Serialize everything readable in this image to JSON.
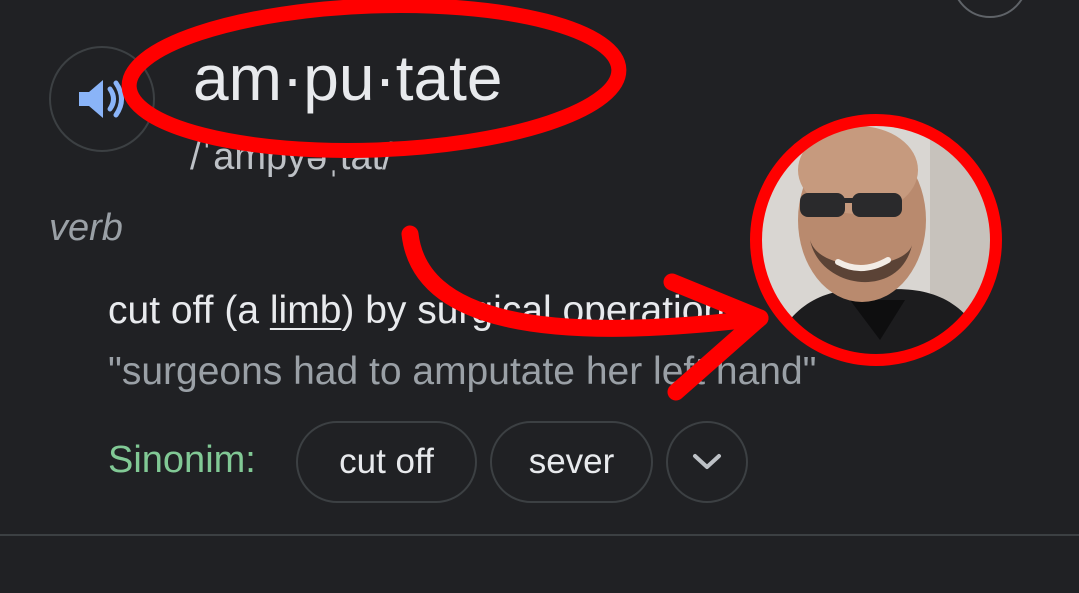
{
  "entry": {
    "word": "am·pu·tate",
    "phonetic": "/ˈampyəˌtāt/",
    "part_of_speech": "verb"
  },
  "sense": {
    "definition_before": "cut off (a ",
    "definition_link": "limb",
    "definition_after": ") by surgical operation.",
    "example": "\"surgeons had to amputate her left hand\""
  },
  "synonyms": {
    "label": "Sinonim:",
    "items": [
      "cut off",
      "sever"
    ],
    "expand_icon": "chevron-down-icon"
  },
  "icons": {
    "pronounce": "speaker-icon"
  },
  "colors": {
    "background": "#202124",
    "primary_text": "#e8eaed",
    "secondary_text": "#9aa0a6",
    "synonym_label": "#81c995",
    "speaker_icon": "#8ab4f8",
    "annotation_red": "#ff0000"
  }
}
